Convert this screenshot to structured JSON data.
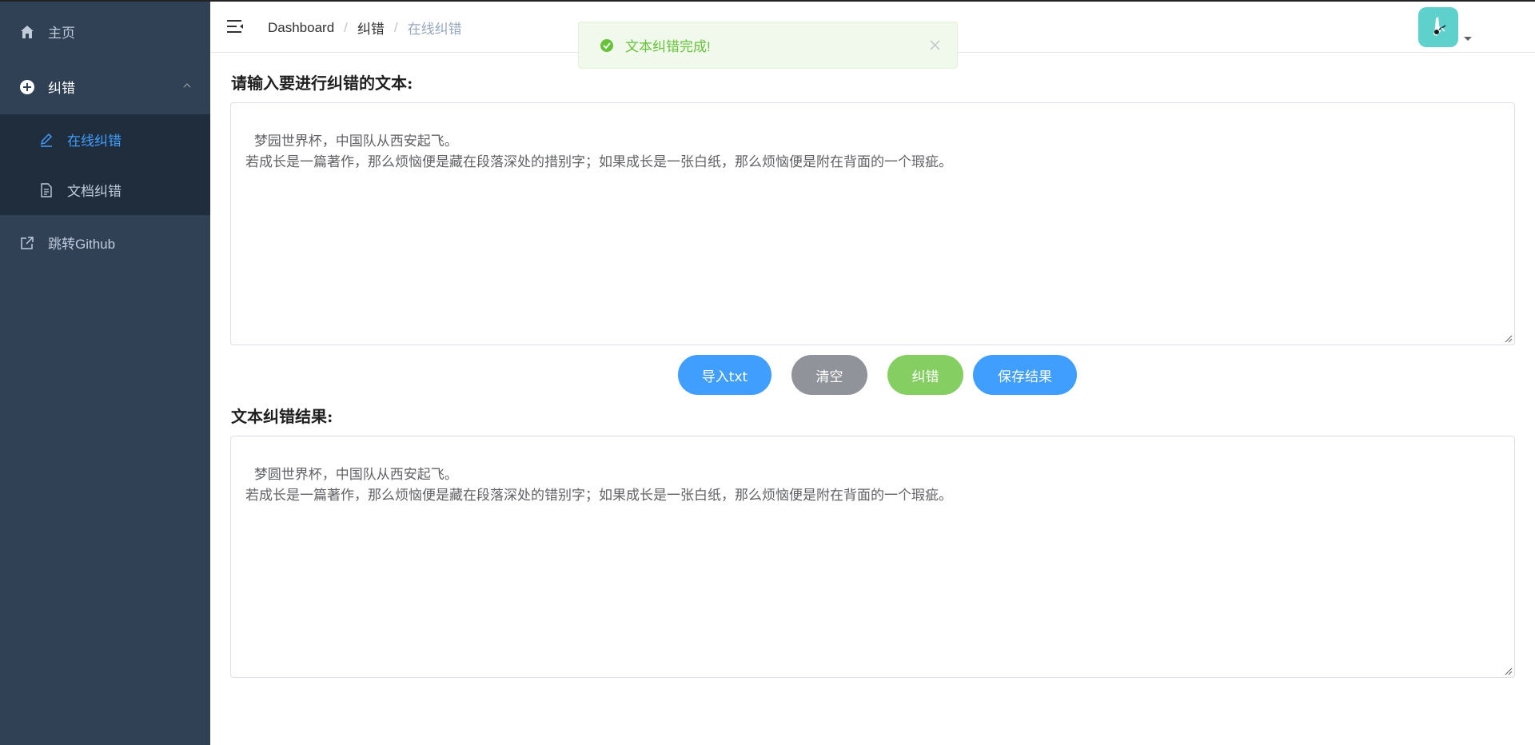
{
  "sidebar": {
    "items": [
      {
        "label": "主页",
        "icon": "home-icon"
      },
      {
        "label": "纠错",
        "icon": "plus-circle-icon"
      },
      {
        "label": "在线纠错",
        "icon": "edit-pen-icon"
      },
      {
        "label": "文档纠错",
        "icon": "document-icon"
      },
      {
        "label": "跳转Github",
        "icon": "external-link-icon"
      }
    ]
  },
  "breadcrumb": {
    "items": [
      "Dashboard",
      "纠错",
      "在线纠错"
    ],
    "separator": "/"
  },
  "toast": {
    "message": "文本纠错完成!",
    "type": "success"
  },
  "input_section": {
    "label": "请输入要进行纠错的文本:",
    "value": "梦园世界杯，中国队从西安起飞。\n若成长是一篇著作，那么烦恼便是藏在段落深处的措别字；如果成长是一张白纸，那么烦恼便是附在背面的一个瑕疵。"
  },
  "buttons": {
    "import": "导入txt",
    "clear": "清空",
    "correct": "纠错",
    "save": "保存结果"
  },
  "result_section": {
    "label": "文本纠错结果:",
    "value": "梦圆世界杯，中国队从西安起飞。\n若成长是一篇著作，那么烦恼便是藏在段落深处的错别字；如果成长是一张白纸，那么烦恼便是附在背面的一个瑕疵。"
  },
  "colors": {
    "sidebar_bg": "#304156",
    "submenu_bg": "#1f2d3d",
    "accent": "#409eff",
    "success": "#67c23a",
    "gray_button": "#909399",
    "green_button": "#85ce61"
  }
}
